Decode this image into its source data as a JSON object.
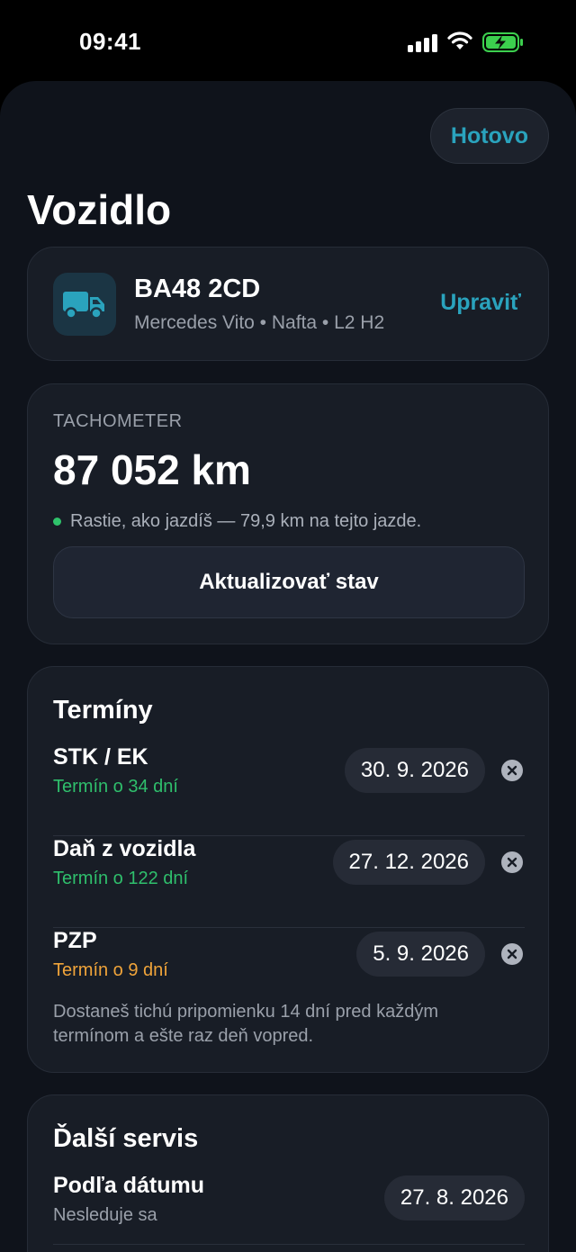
{
  "status_bar": {
    "time": "09:41"
  },
  "header": {
    "done_label": "Hotovo",
    "title": "Vozidlo"
  },
  "vehicle": {
    "plate": "BA48 2CD",
    "details": "Mercedes Vito • Nafta • L2 H2",
    "edit_label": "Upraviť",
    "icon": "truck-icon",
    "icon_color": "#2aa3bd"
  },
  "tachometer": {
    "label": "TACHOMETER",
    "value": "87 052 km",
    "note": "Rastie, ako jazdíš — 79,9 km na tejto jazde.",
    "update_label": "Aktualizovať stav"
  },
  "deadlines": {
    "heading": "Termíny",
    "items": [
      {
        "name": "STK / EK",
        "status": "Termín o 34 dní",
        "status_color": "#2fbf6c",
        "date": "30. 9. 2026"
      },
      {
        "name": "Daň z vozidla",
        "status": "Termín o 122 dní",
        "status_color": "#2fbf6c",
        "date": "27. 12. 2026"
      },
      {
        "name": "PZP",
        "status": "Termín o 9 dní",
        "status_color": "#f0a43a",
        "date": "5. 9. 2026"
      }
    ],
    "footnote": "Dostaneš tichú pripomienku 14 dní pred každým termínom a ešte raz deň vopred."
  },
  "service": {
    "heading": "Ďalší servis",
    "items": [
      {
        "name": "Podľa dátumu",
        "status": "Nesleduje sa",
        "date": "27. 8. 2026"
      }
    ]
  },
  "colors": {
    "accent": "#2aa3bd",
    "ok": "#2fbf6c",
    "warn": "#f0a43a",
    "background": "#0f131b"
  }
}
